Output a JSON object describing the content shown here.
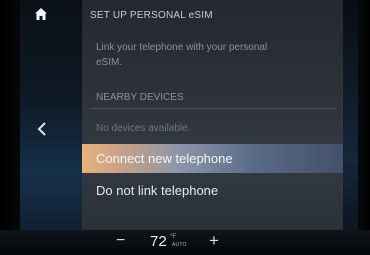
{
  "sidebar": {
    "home_icon": "home-icon",
    "back_icon": "chevron-left-icon"
  },
  "panel": {
    "title": "SET UP PERSONAL eSIM",
    "description": "Link your telephone with your personal eSIM.",
    "section_header": "NEARBY DEVICES",
    "empty_message": "No devices available.",
    "options": [
      {
        "label": "Connect new telephone",
        "selected": true
      },
      {
        "label": "Do not link telephone",
        "selected": false
      }
    ]
  },
  "climate": {
    "minus_label": "−",
    "temperature": "72",
    "unit": "°F",
    "mode": "AUTO",
    "plus_label": "+"
  },
  "colors": {
    "highlight_start": "#e6b37c",
    "highlight_end": "#43506a",
    "panel_bg": "#2d3239"
  }
}
